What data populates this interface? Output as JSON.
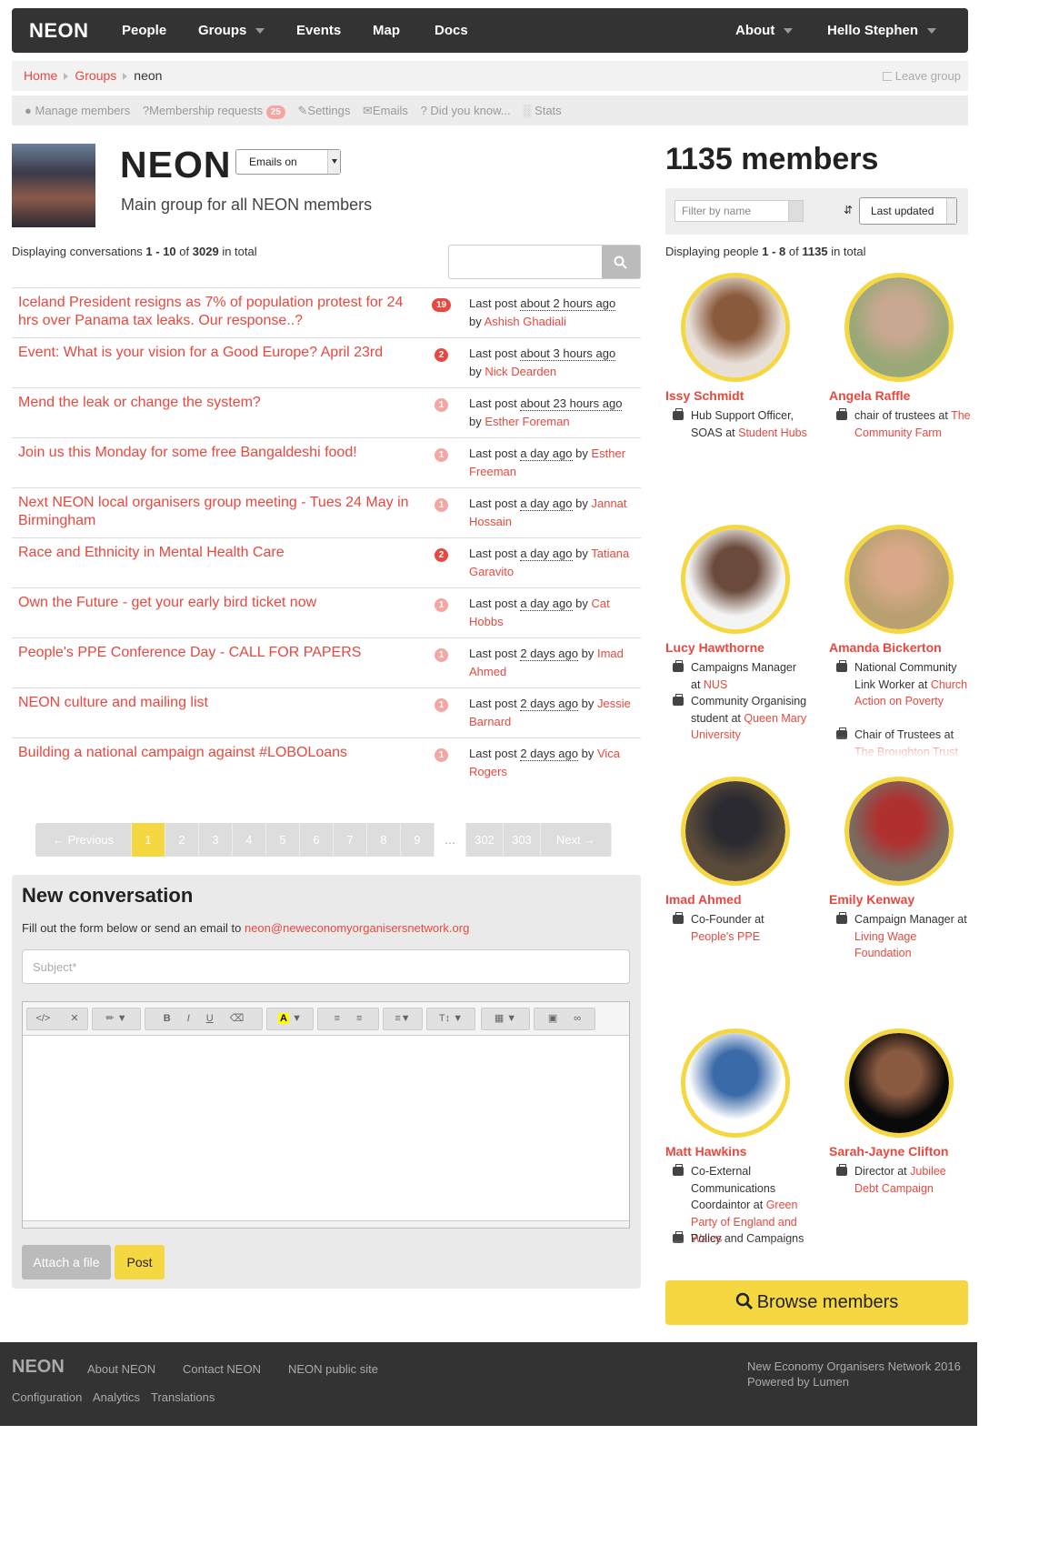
{
  "nav": {
    "brand": "NEON",
    "people": "People",
    "groups": "Groups",
    "events": "Events",
    "map": "Map",
    "docs": "Docs",
    "about": "About",
    "user": "Hello Stephen"
  },
  "breadcrumb": {
    "home": "Home",
    "groups": "Groups",
    "current": "neon",
    "leave": "Leave group"
  },
  "tabs": {
    "manage": "Manage members",
    "requests": "Membership requests",
    "requests_count": "25",
    "settings": "Settings",
    "emails": "Emails",
    "didyouknow": "Did you know...",
    "stats": "Stats"
  },
  "group": {
    "title": "NEON",
    "emails_select": "Emails on",
    "description": "Main group for all NEON members"
  },
  "conversations_summary": {
    "prefix": "Displaying conversations",
    "range": "1 - 10",
    "of": "of",
    "total": "3029",
    "suffix": "in total"
  },
  "conversations": [
    {
      "title": "Iceland President resigns as 7% of population protest for 24 hrs over Panama tax leaks. Our response..?",
      "count": "19",
      "style": "strong",
      "ago": "about 2 hours ago",
      "author": "Ashish Ghadiali",
      "layout": "b"
    },
    {
      "title": "Event: What is your vision for a Good Europe? April 23rd",
      "count": "2",
      "style": "strong",
      "ago": "about 3 hours ago",
      "author": "Nick Dearden",
      "layout": "b"
    },
    {
      "title": "Mend the leak or change the system?",
      "count": "1",
      "style": "pale",
      "ago": "about 23 hours ago",
      "author": "Esther Foreman",
      "layout": "b"
    },
    {
      "title": "Join us this Monday for some free Bangaldeshi food!",
      "count": "1",
      "style": "pale",
      "ago": "a day ago",
      "author": "Esther Freeman",
      "layout": "i"
    },
    {
      "title": "Next NEON local organisers group meeting - Tues 24 May in Birmingham",
      "count": "1",
      "style": "pale",
      "ago": "a day ago",
      "author": "Jannat Hossain",
      "layout": "i"
    },
    {
      "title": "Race and Ethnicity in Mental Health Care",
      "count": "2",
      "style": "strong",
      "ago": "a day ago",
      "author": "Tatiana Garavito",
      "layout": "i"
    },
    {
      "title": "Own the Future - get your early bird ticket now",
      "count": "1",
      "style": "pale",
      "ago": "a day ago",
      "author": "Cat Hobbs",
      "layout": "i"
    },
    {
      "title": "People's PPE Conference Day - CALL FOR PAPERS",
      "count": "1",
      "style": "pale",
      "ago": "2 days ago",
      "author": "Imad Ahmed",
      "layout": "i"
    },
    {
      "title": "NEON culture and mailing list",
      "count": "1",
      "style": "pale",
      "ago": "2 days ago",
      "author": "Jessie Barnard",
      "layout": "i"
    },
    {
      "title": "Building a national campaign against #LOBOLoans",
      "count": "1",
      "style": "pale",
      "ago": "2 days ago",
      "author": "Vica Rogers",
      "layout": "i"
    }
  ],
  "conv_labels": {
    "last_post": "Last post",
    "by": "by"
  },
  "pagination": {
    "previous": "← Previous",
    "next": "Next →",
    "pages": [
      "1",
      "2",
      "3",
      "4",
      "5",
      "6",
      "7",
      "8",
      "9",
      "…",
      "302",
      "303"
    ],
    "current": "1"
  },
  "new_conversation": {
    "heading": "New conversation",
    "instructions": "Fill out the form below or send an email to",
    "email": "neon@neweconomyorganisersnetwork.org",
    "subject_placeholder": "Subject*",
    "attach": "Attach a file",
    "post": "Post"
  },
  "members": {
    "title": "1135 members",
    "filter_placeholder": "Filter by name",
    "sort": "Last updated",
    "summary_prefix": "Displaying people",
    "summary_range": "1 - 8",
    "summary_of": "of",
    "summary_total": "1135",
    "summary_suffix": "in total",
    "browse": "Browse members"
  },
  "people": [
    {
      "name": "Issy Schmidt",
      "roles": [
        {
          "text": "Hub Support Officer, SOAS at ",
          "org": "Student Hubs"
        }
      ],
      "faded": false,
      "colors": [
        "#e8e0d8",
        "#8a5a3c"
      ]
    },
    {
      "name": "Angela Raffle",
      "roles": [
        {
          "text": "chair of trustees at ",
          "org": "The Community Farm"
        }
      ],
      "faded": false,
      "colors": [
        "#9aa878",
        "#c8a890"
      ]
    },
    {
      "name": "Lucy Hawthorne",
      "roles": [
        {
          "text": "Campaigns Manager at ",
          "org": "NUS"
        },
        {
          "text": "Community Organising student at ",
          "org": "Queen Mary University"
        }
      ],
      "faded": true,
      "colors": [
        "#f4f4f4",
        "#6a4a3a"
      ]
    },
    {
      "name": "Amanda Bickerton",
      "roles": [
        {
          "text": "National Community Link Worker at ",
          "org": "Church Action on Poverty"
        },
        {
          "text": "Chair of Trustees at ",
          "org": "The Broughton Trust"
        }
      ],
      "faded": true,
      "colors": [
        "#b8a070",
        "#d8a888"
      ]
    },
    {
      "name": "Imad Ahmed",
      "roles": [
        {
          "text": "Co-Founder at ",
          "org": "People's PPE"
        }
      ],
      "faded": false,
      "colors": [
        "#5a4a3a",
        "#2a2a30"
      ]
    },
    {
      "name": "Emily Kenway",
      "roles": [
        {
          "text": "Campaign Manager at ",
          "org": "Living Wage Foundation"
        }
      ],
      "faded": false,
      "colors": [
        "#7a6a60",
        "#b03030"
      ]
    },
    {
      "name": "Matt Hawkins",
      "roles": [
        {
          "text": "Co-External Communications Coordaintor at ",
          "org": "Green Party of England and Wales"
        },
        {
          "text": "Policy and Campaigns",
          "org": ""
        }
      ],
      "faded": true,
      "colors": [
        "#ffffff",
        "#3a6aa8"
      ]
    },
    {
      "name": "Sarah-Jayne Clifton",
      "roles": [
        {
          "text": "Director at ",
          "org": "Jubilee Debt Campaign"
        }
      ],
      "faded": false,
      "colors": [
        "#0a0a0a",
        "#8a5a40"
      ]
    }
  ],
  "footer": {
    "brand": "NEON",
    "about": "About NEON",
    "contact": "Contact NEON",
    "public": "NEON public site",
    "config": "Configuration",
    "analytics": "Analytics",
    "translations": "Translations",
    "copyright": "New Economy Organisers Network 2016",
    "powered": "Powered by Lumen"
  }
}
